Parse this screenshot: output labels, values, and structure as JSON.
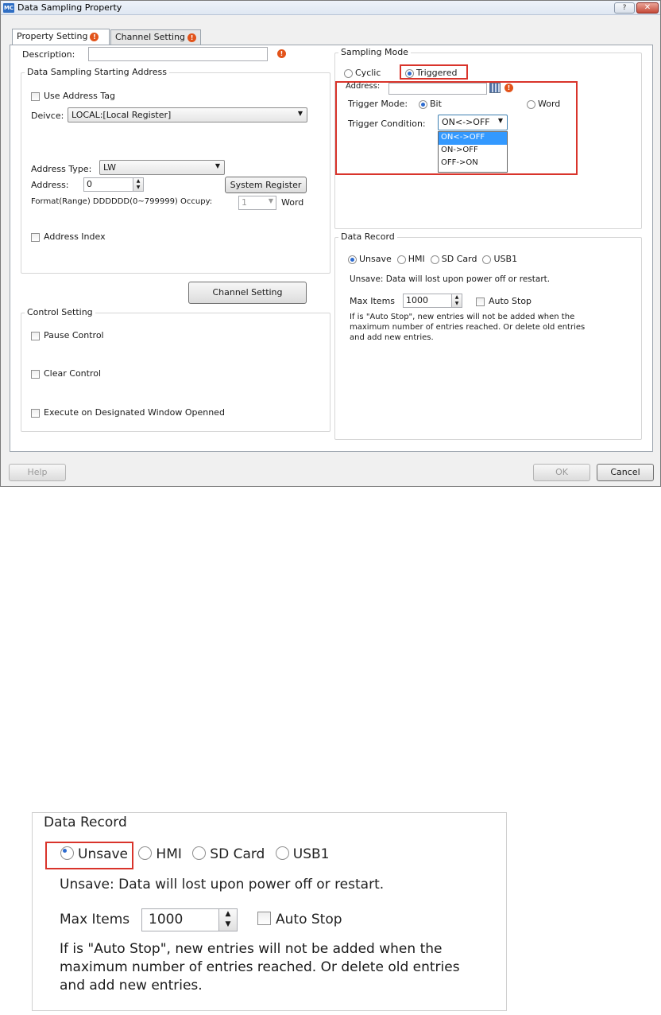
{
  "window": {
    "title": "Data Sampling Property",
    "app_icon_text": "MC",
    "help_glyph": "?",
    "close_glyph": "✕"
  },
  "tabs": [
    {
      "label": "Property Setting",
      "active": true
    },
    {
      "label": "Channel Setting",
      "active": false
    }
  ],
  "property": {
    "description_label": "Description:",
    "description_value": "",
    "starting_address_group": "Data Sampling Starting Address",
    "use_address_tag": "Use Address Tag",
    "device_label": "Deivce:",
    "device_value": "LOCAL:[Local Register]",
    "address_type_label": "Address Type:",
    "address_type_value": "LW",
    "address_label": "Address:",
    "address_value": "0",
    "system_register_button": "System Register",
    "format_label": "Format(Range) DDDDDD(0~799999) Occupy:",
    "occupy_value": "1",
    "occupy_unit": "Word",
    "address_index": "Address Index",
    "channel_setting_button": "Channel Setting"
  },
  "control": {
    "group_label": "Control Setting",
    "pause_control": "Pause Control",
    "clear_control": "Clear Control",
    "execute_window": "Execute on Designated Window Openned"
  },
  "sampling_mode": {
    "group_label": "Sampling Mode",
    "cyclic": "Cyclic",
    "triggered": "Triggered",
    "selected": "Triggered",
    "address_label": "Address:",
    "trigger_mode_label": "Trigger Mode:",
    "trigger_bit": "Bit",
    "trigger_word": "Word",
    "trigger_mode_selected": "Bit",
    "trigger_condition_label": "Trigger Condition:",
    "trigger_condition_value": "ON<->OFF",
    "trigger_condition_options": [
      "ON<->OFF",
      "ON->OFF",
      "OFF->ON"
    ]
  },
  "data_record": {
    "group_label": "Data Record",
    "options": [
      "Unsave",
      "HMI",
      "SD Card",
      "USB1"
    ],
    "selected": "Unsave",
    "description": "Unsave: Data will lost upon power off or restart.",
    "max_items_label": "Max Items",
    "max_items_value": "1000",
    "auto_stop": "Auto Stop",
    "note_lines": [
      "If is \"Auto Stop\", new entries will not be added when the",
      "maximum number of entries reached. Or delete old entries",
      "and add new entries."
    ]
  },
  "footer": {
    "help_button": "Help",
    "ok_button": "OK",
    "cancel_button": "Cancel"
  },
  "colors": {
    "highlight_red": "#d9342b",
    "selection_blue": "#3399ff",
    "warning_orange": "#e2531a"
  },
  "icons": [
    "warning-icon",
    "address-picker-icon",
    "dropdown-arrow-icon",
    "spin-icon",
    "help-icon",
    "close-icon"
  ]
}
